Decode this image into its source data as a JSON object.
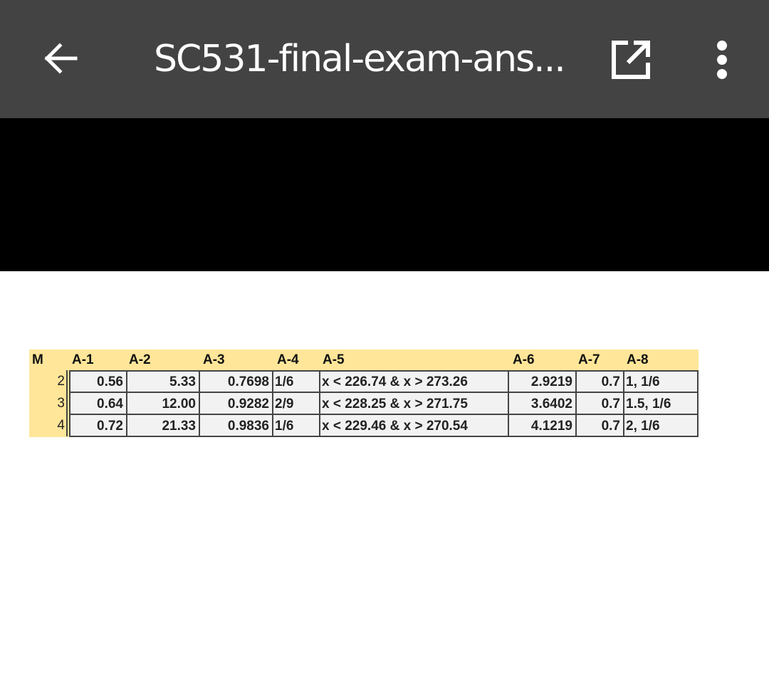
{
  "app_bar": {
    "title": "SC531-final-exam-ans...",
    "back_icon": "arrow-left-icon",
    "open_icon": "open-in-new-icon",
    "more_icon": "more-vert-icon",
    "colors": {
      "app_bar_bg": "#434343",
      "header_fill": "#ffe699",
      "cell_fill": "#f2f2f2"
    }
  },
  "table": {
    "headers": [
      "M",
      "A-1",
      "A-2",
      "A-3",
      "A-4",
      "A-5",
      "A-6",
      "A-7",
      "A-8"
    ],
    "rows": [
      [
        "2",
        "0.56",
        "5.33",
        "0.7698",
        "1/6",
        "x < 226.74 & x > 273.26",
        "2.9219",
        "0.7",
        "1, 1/6"
      ],
      [
        "3",
        "0.64",
        "12.00",
        "0.9282",
        "2/9",
        "x < 228.25 & x > 271.75",
        "3.6402",
        "0.7",
        "1.5, 1/6"
      ],
      [
        "4",
        "0.72",
        "21.33",
        "0.9836",
        "1/6",
        "x < 229.46 & x > 270.54",
        "4.1219",
        "0.7",
        "2, 1/6"
      ]
    ]
  }
}
